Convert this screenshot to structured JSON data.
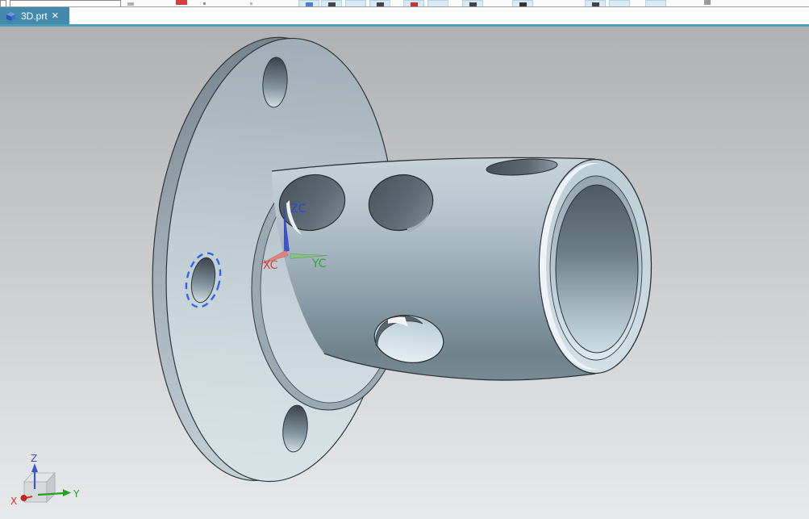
{
  "tab_bar": {
    "active_tab": {
      "label": "3D.prt",
      "close_glyph": "✕"
    }
  },
  "viewport": {
    "background_top": "#b0b1b3",
    "background_bottom": "#e8e9ea",
    "accent_line_color": "#4a9cb8",
    "tab_color": "#4289ab",
    "part_color": "#b7c6cd",
    "highlight_dash_color": "#2e66e8",
    "wcs_triad": {
      "x_label": "XC",
      "y_label": "YC",
      "z_label": "ZC",
      "x_color": "#d43c3c",
      "y_color": "#2fa62f",
      "z_color": "#2b46d8"
    },
    "view_triad": {
      "x_label": "X",
      "y_label": "Y",
      "z_label": "Z",
      "x_color": "#d83030",
      "y_color": "#22a022",
      "z_color": "#3c57c9"
    }
  }
}
